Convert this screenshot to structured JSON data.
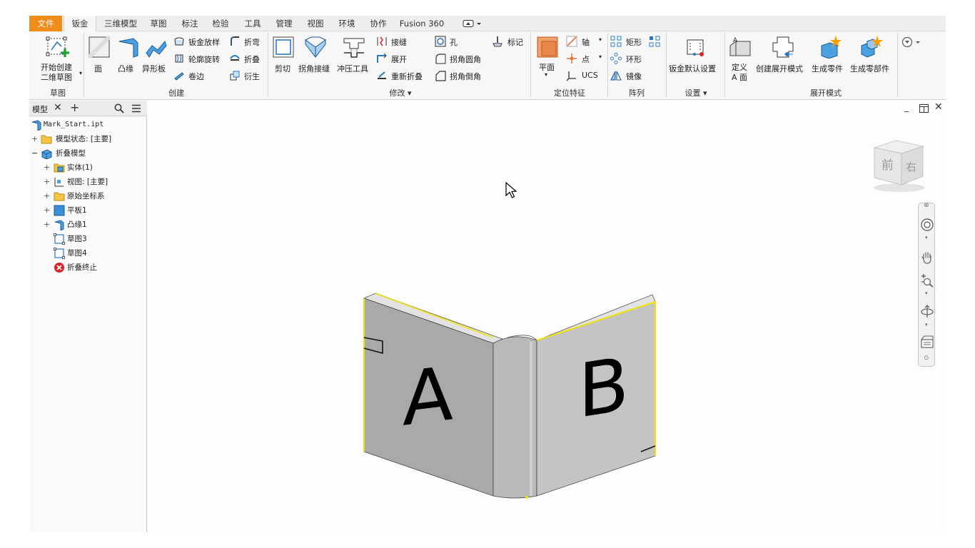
{
  "tabs": [
    "文件",
    "钣金",
    "三维模型",
    "草图",
    "标注",
    "检验",
    "工具",
    "管理",
    "视图",
    "环境",
    "协作",
    "Fusion 360"
  ],
  "ribbon": {
    "sketch": {
      "title": "草图",
      "start_sketch_line1": "开始创建",
      "start_sketch_line2": "二维草图"
    },
    "create": {
      "title": "创建",
      "face": "面",
      "flange": "凸缘",
      "contour_flange": "异形板",
      "lofted_flange": "钣金放样",
      "contour_roll": "轮廓旋转",
      "hem": "卷边",
      "bend": "折弯",
      "fold": "折叠",
      "derive": "衍生"
    },
    "modify": {
      "title": "修改",
      "cut": "剪切",
      "corner_seam": "拐角接缝",
      "punch_tool": "冲压工具",
      "rip": "接缝",
      "unfold": "展开",
      "refold": "重新折叠",
      "hole": "孔",
      "corner_round": "拐角圆角",
      "corner_chamfer": "拐角倒角",
      "mark": "标记"
    },
    "work_features": {
      "title": "定位特征",
      "plane": "平面",
      "axis": "轴",
      "point": "点",
      "ucs": "UCS"
    },
    "pattern": {
      "title": "阵列",
      "rectangular": "矩形",
      "circular": "环形",
      "mirror": "镜像"
    },
    "setup": {
      "title": "设置",
      "defaults": "钣金默认设置"
    },
    "flat_pattern": {
      "title": "展开模式",
      "define_a_side_line1": "定义",
      "define_a_side_line2": "A 面",
      "create_flat": "创建展开模式",
      "make_part": "生成零件",
      "make_components": "生成零部件"
    }
  },
  "browser": {
    "tab": "模型",
    "items": [
      {
        "label": "Mark_Start.ipt"
      },
      {
        "label": "模型状态: [主要]"
      },
      {
        "label": "折叠模型"
      },
      {
        "label": "实体(1)"
      },
      {
        "label": "视图: [主要]"
      },
      {
        "label": "原始坐标系"
      },
      {
        "label": "平板1"
      },
      {
        "label": "凸缘1"
      },
      {
        "label": "草图3"
      },
      {
        "label": "草图4"
      },
      {
        "label": "折叠终止"
      }
    ]
  },
  "viewcube": {
    "front": "前",
    "right": "右"
  },
  "model": {
    "face_a": "A",
    "face_b": "B"
  },
  "colors": {
    "file_tab": "#f08c1a",
    "selection_edge": "#f2e300",
    "sheet_face_left": "#a9a9a9",
    "sheet_face_right": "#c4c4c4",
    "error_icon": "#d8232a"
  }
}
